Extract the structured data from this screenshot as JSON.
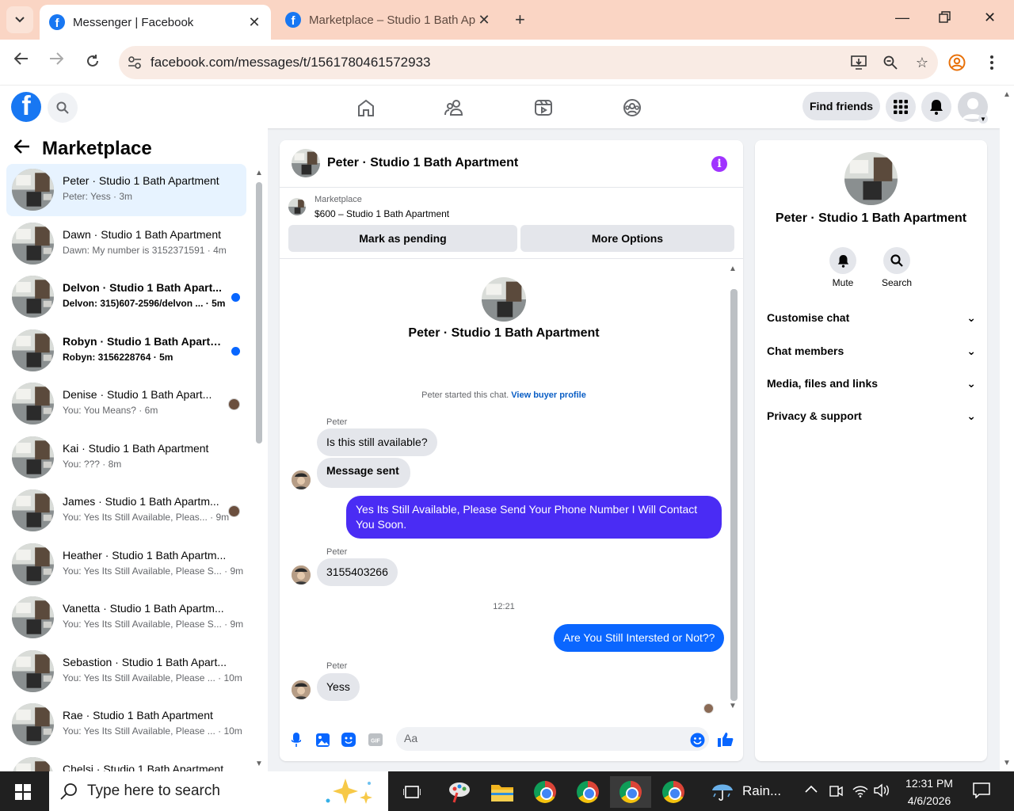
{
  "browser": {
    "tabs": [
      {
        "title": "Messenger | Facebook",
        "active": true
      },
      {
        "title": "Marketplace – Studio 1 Bath Ap",
        "active": false
      }
    ],
    "url": "facebook.com/messages/t/1561780461572933"
  },
  "fb_header": {
    "find_friends": "Find friends"
  },
  "sidebar": {
    "title": "Marketplace",
    "conversations": [
      {
        "name": "Peter · Studio 1 Bath Apartment",
        "preview": "Peter: Yess · 3m",
        "selected": true,
        "unread": false
      },
      {
        "name": "Dawn · Studio 1 Bath Apartment",
        "preview": "Dawn: My number is 3152371591 · 4m",
        "selected": false,
        "unread": false
      },
      {
        "name": "Delvon · Studio 1 Bath Apart...",
        "preview": "Delvon: 315)607-2596/delvon ... · 5m",
        "selected": false,
        "unread": true
      },
      {
        "name": "Robyn · Studio 1 Bath Apartm...",
        "preview": "Robyn: 3156228764 · 5m",
        "selected": false,
        "unread": true
      },
      {
        "name": "Denise · Studio 1 Bath Apart...",
        "preview": "You: You Means? · 6m",
        "selected": false,
        "unread": false,
        "seen_avatar": true
      },
      {
        "name": "Kai · Studio 1 Bath Apartment",
        "preview": "You: ??? · 8m",
        "selected": false,
        "unread": false
      },
      {
        "name": "James · Studio 1 Bath Apartm...",
        "preview": "You: Yes Its Still Available, Pleas... · 9m",
        "selected": false,
        "unread": false,
        "seen_avatar": true
      },
      {
        "name": "Heather · Studio 1 Bath Apartm...",
        "preview": "You: Yes Its Still Available, Please S... · 9m",
        "selected": false,
        "unread": false
      },
      {
        "name": "Vanetta · Studio 1 Bath Apartm...",
        "preview": "You: Yes Its Still Available, Please S... · 9m",
        "selected": false,
        "unread": false
      },
      {
        "name": "Sebastion · Studio 1 Bath Apart...",
        "preview": "You: Yes Its Still Available, Please ... · 10m",
        "selected": false,
        "unread": false
      },
      {
        "name": "Rae · Studio 1 Bath Apartment",
        "preview": "You: Yes Its Still Available, Please ... · 10m",
        "selected": false,
        "unread": false
      },
      {
        "name": "Chelsi · Studio 1 Bath Apartment",
        "preview": "",
        "selected": false,
        "unread": false
      }
    ]
  },
  "chat": {
    "title": "Peter · Studio 1 Bath Apartment",
    "marketplace_label": "Marketplace",
    "listing": "$600 – Studio 1 Bath Apartment",
    "mark_pending": "Mark as pending",
    "more_options": "More Options",
    "intro_name": "Peter · Studio 1 Bath Apartment",
    "started_text": "Peter started this chat.",
    "view_profile": "View buyer profile",
    "messages": [
      {
        "sender": "Peter",
        "text": "Is this still available?",
        "dir": "in"
      },
      {
        "sender": "",
        "text": "Message sent",
        "dir": "in"
      },
      {
        "sender": "",
        "text": "Yes Its Still Available, Please Send Your Phone Number I Will Contact You Soon.",
        "dir": "out"
      },
      {
        "sender": "Peter",
        "text": "3155403266",
        "dir": "in"
      },
      {
        "sender": "",
        "text": "Are You Still Intersted or Not??",
        "dir": "out"
      },
      {
        "sender": "Peter",
        "text": "Yess",
        "dir": "in"
      }
    ],
    "timestamp": "12:21",
    "composer_placeholder": "Aa"
  },
  "info_panel": {
    "name": "Peter · Studio 1 Bath Apartment",
    "actions": [
      "Mute",
      "Search"
    ],
    "sections": [
      "Customise chat",
      "Chat members",
      "Media, files and links",
      "Privacy & support"
    ]
  },
  "taskbar": {
    "search_placeholder": "Type here to search",
    "weather": "Rain...",
    "time": "12:31 PM",
    "date": "4/6/2026"
  },
  "colors": {
    "fb_blue": "#1877f2",
    "outgoing_bubble": "#4a2cf4",
    "outgoing_bubble_recent": "#0a66ff",
    "selected_row": "#e7f3ff",
    "unread_dot": "#0866ff"
  }
}
